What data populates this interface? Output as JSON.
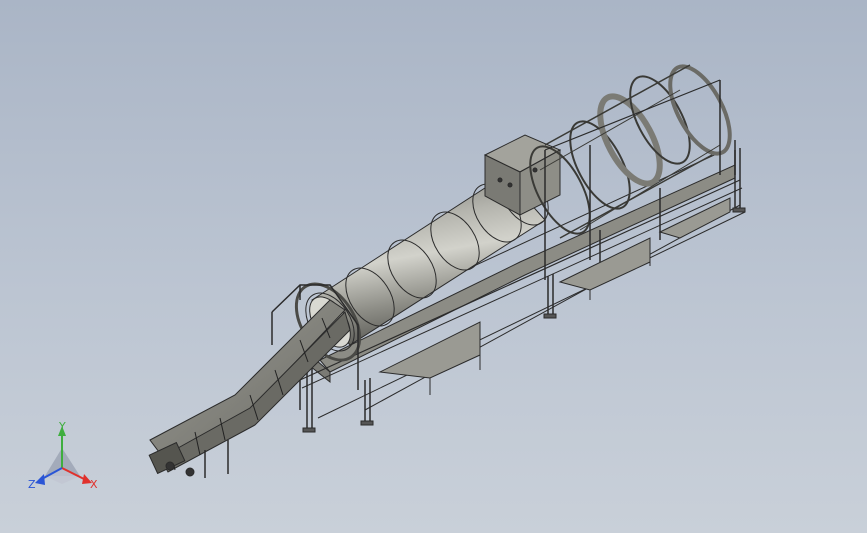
{
  "scene": {
    "background_top": "#aab5c6",
    "background_bottom": "#c9d0d9",
    "part_color": "#8f8f87",
    "edge_color": "#2b2b2b"
  },
  "triad": {
    "x_label": "X",
    "y_label": "Y",
    "z_label": "Z",
    "x_color": "#e0312c",
    "y_color": "#3fae3f",
    "z_color": "#2a55d6"
  }
}
